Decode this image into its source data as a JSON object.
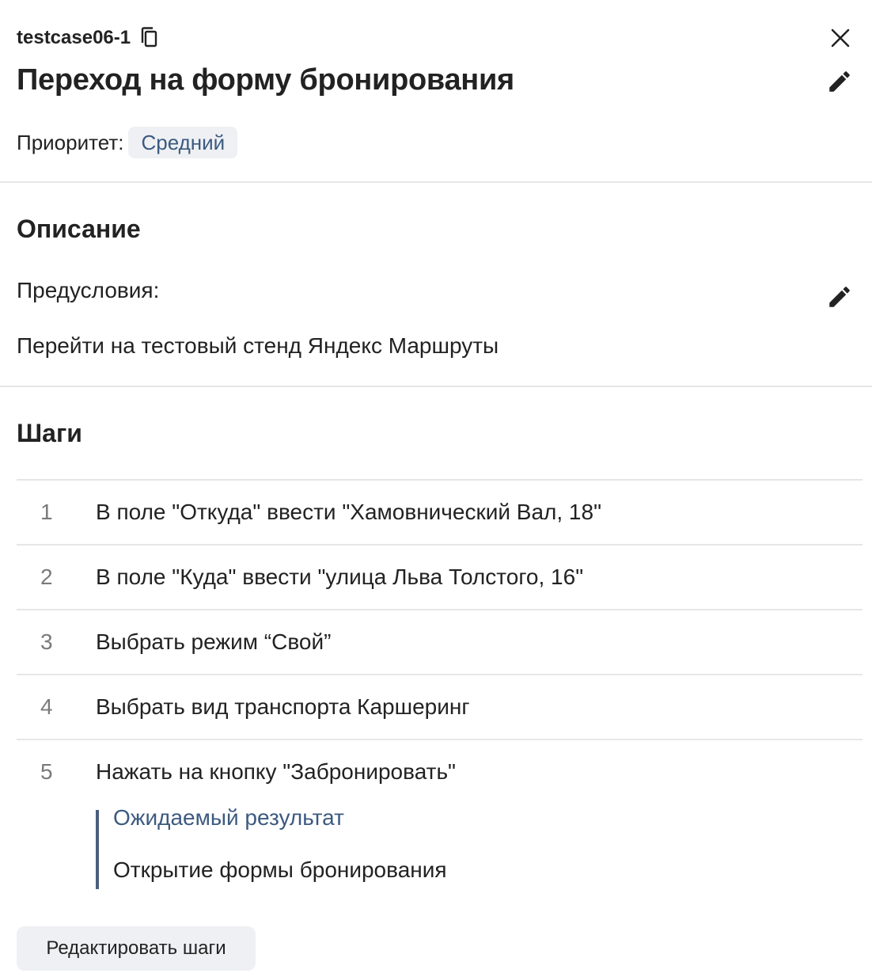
{
  "header": {
    "case_id": "testcase06-1",
    "title": "Переход на форму бронирования",
    "priority_label": "Приоритет:",
    "priority_value": "Средний"
  },
  "description": {
    "title": "Описание",
    "preconditions_label": "Предусловия:",
    "preconditions_text": "Перейти на тестовый стенд Яндекс Маршруты"
  },
  "steps": {
    "title": "Шаги",
    "items": [
      {
        "num": "1",
        "text": "В поле \"Откуда\" ввести \"Хамовнический Вал, 18\""
      },
      {
        "num": "2",
        "text": "В поле \"Куда\" ввести \"улица Льва Толстого, 16\""
      },
      {
        "num": "3",
        "text": "Выбрать режим “Свой”"
      },
      {
        "num": "4",
        "text": "Выбрать вид транспорта Каршеринг"
      },
      {
        "num": "5",
        "text": "Нажать на кнопку \"Забронировать\""
      }
    ],
    "expected_label": "Ожидаемый результат",
    "expected_text": "Открытие формы бронирования",
    "edit_button": "Редактировать шаги"
  },
  "icons": {
    "copy": "copy-icon",
    "close": "close-icon",
    "edit": "pencil-icon"
  },
  "colors": {
    "accent": "#3c5a80",
    "badge_bg": "#eef0f3",
    "divider": "#e6e6e6"
  }
}
